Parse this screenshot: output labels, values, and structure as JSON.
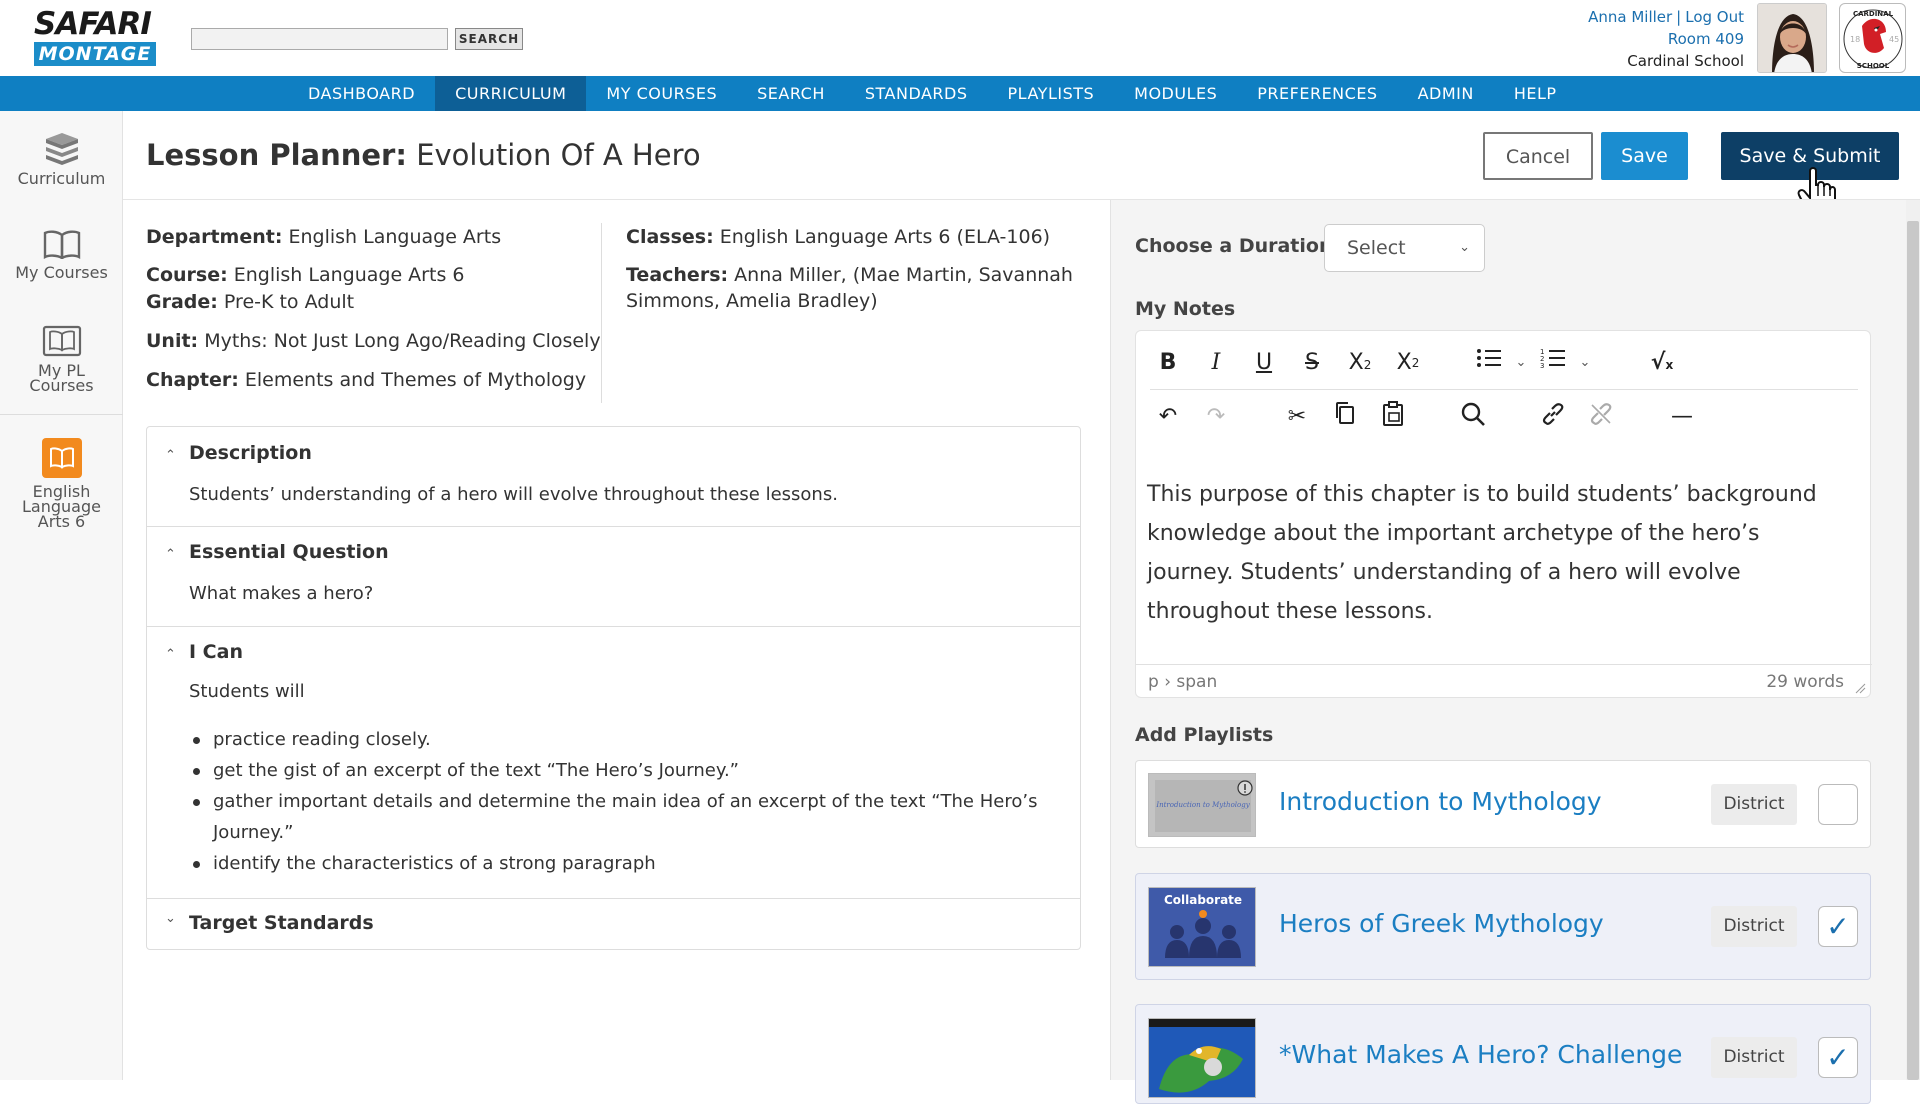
{
  "header": {
    "logo_top": "SAFARI",
    "logo_bottom": "MONTAGE",
    "search_placeholder": "",
    "search_button": "SEARCH",
    "user_name": "Anna Miller",
    "user_sep": "|",
    "logout": "Log Out",
    "room": "Room 409",
    "school": "Cardinal School",
    "school_logo_text": "CARDINAL SCHOOL"
  },
  "nav": {
    "items": [
      {
        "label": "DASHBOARD"
      },
      {
        "label": "CURRICULUM"
      },
      {
        "label": "MY COURSES"
      },
      {
        "label": "SEARCH"
      },
      {
        "label": "STANDARDS"
      },
      {
        "label": "PLAYLISTS"
      },
      {
        "label": "MODULES"
      },
      {
        "label": "PREFERENCES"
      },
      {
        "label": "ADMIN"
      },
      {
        "label": "HELP"
      }
    ],
    "active": "CURRICULUM"
  },
  "sidebar": {
    "items": [
      {
        "label": "Curriculum",
        "icon": "books-stack-icon"
      },
      {
        "label": "My Courses",
        "icon": "open-book-icon"
      },
      {
        "label_line1": "My PL",
        "label_line2": "Courses",
        "icon": "book-frame-icon"
      },
      {
        "label_line1": "English",
        "label_line2": "Language",
        "label_line3": "Arts 6",
        "icon": "course-book-icon",
        "accent": "#f28a1e"
      }
    ]
  },
  "page": {
    "title_prefix": "Lesson Planner:",
    "title_name": "Evolution Of A Hero",
    "cancel": "Cancel",
    "save": "Save",
    "save_submit": "Save & Submit"
  },
  "info": {
    "department_label": "Department:",
    "department": "English Language Arts",
    "course_label": "Course:",
    "course": "English Language Arts 6",
    "grade_label": "Grade:",
    "grade": "Pre-K to Adult",
    "unit_label": "Unit:",
    "unit": "Myths: Not Just Long Ago/Reading Closely",
    "chapter_label": "Chapter:",
    "chapter": "Elements and Themes of Mythology",
    "classes_label": "Classes:",
    "classes": "English Language Arts 6 (ELA-106)",
    "teachers_label": "Teachers:",
    "teachers_line1": "Anna Miller, (Mae Martin, Savannah",
    "teachers_line2": "Simmons, Amelia Bradley)"
  },
  "accordion": {
    "description_title": "Description",
    "description_body": "Students’ understanding of a hero will evolve throughout these lessons.",
    "eq_title": "Essential Question",
    "eq_body": "What makes a hero?",
    "ican_title": "I Can",
    "ican_intro": "Students will",
    "ican_items": [
      "practice reading closely.",
      "get the gist of an excerpt of the text “The Hero’s Journey.”",
      "gather important details and determine the main idea of an excerpt of the text “The Hero’s Journey.”",
      "identify the characteristics of a strong paragraph"
    ],
    "standards_title": "Target Standards"
  },
  "right": {
    "duration_label": "Choose a Duration",
    "duration_value": "Select",
    "notes_label": "My Notes",
    "notes_text": "This purpose of this chapter is to build students’ background knowledge about the important archetype of the hero’s journey. Students’ understanding of a hero will evolve throughout these lessons.",
    "editor_path": "p › span",
    "word_count": "29 words",
    "playlists_label": "Add Playlists",
    "playlists": [
      {
        "title": "Introduction to Mythology",
        "badge": "District",
        "checked": false,
        "thumb_text": "Introduction to Mythology"
      },
      {
        "title": "Heros of Greek Mythology",
        "badge": "District",
        "checked": true,
        "thumb_text": "Collaborate"
      },
      {
        "title": "*What Makes A Hero? Challenge",
        "badge": "District",
        "checked": true,
        "thumb_text": ""
      }
    ]
  },
  "colors": {
    "nav_blue": "#0f7fc2",
    "nav_active": "#0d5f96",
    "save_blue": "#1b8dd0",
    "submit_navy": "#0d3f66",
    "link_blue": "#1b7ec2",
    "accent_orange": "#f28a1e"
  }
}
